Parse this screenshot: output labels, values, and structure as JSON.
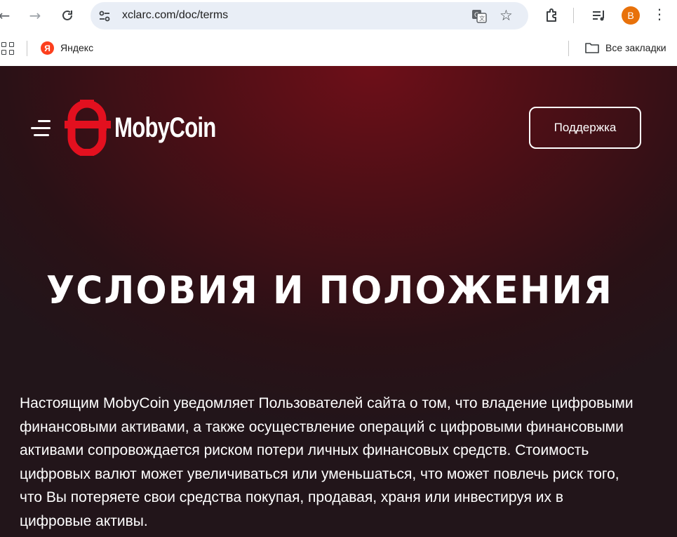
{
  "browser": {
    "url": "xclarc.com/doc/terms",
    "avatar_letter": "B",
    "avatar_color": "#e8710a"
  },
  "bookmarks": {
    "items": [
      {
        "label": "Яндекс",
        "icon": "yandex-logo"
      }
    ],
    "all_bookmarks_label": "Все закладки"
  },
  "site": {
    "brand": "MobyCoin",
    "brand_color": "#e3101f",
    "support_label": "Поддержка"
  },
  "hero": {
    "title": "УСЛОВИЯ И ПОЛОЖЕНИЯ"
  },
  "content": {
    "paragraph": "Настоящим MobyCoin уведомляет Пользователей сайта о том, что владение цифровыми финансовыми активами, а также осуществление операций с цифровыми финансовыми активами сопровождается риском потери личных финансовых средств. Стоимость цифровых валют может увеличиваться или уменьшаться, что может повлечь риск того, что Вы потеряете свои средства покупая, продавая, храня или инвестируя их в цифровые активы."
  }
}
